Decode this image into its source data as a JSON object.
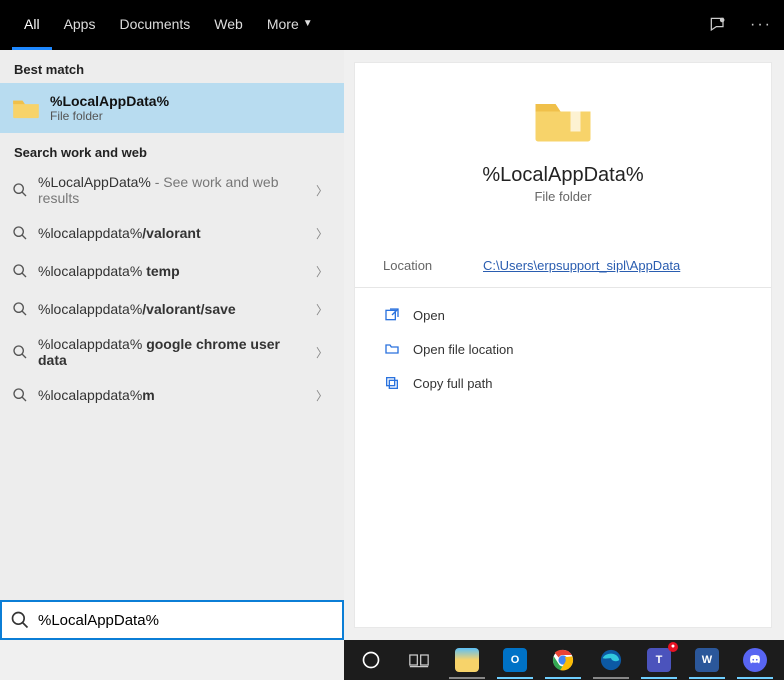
{
  "tabs": {
    "all": "All",
    "apps": "Apps",
    "documents": "Documents",
    "web": "Web",
    "more": "More"
  },
  "sections": {
    "best_match": "Best match",
    "search_web": "Search work and web"
  },
  "best": {
    "title": "%LocalAppData%",
    "sub": "File folder"
  },
  "webresults": [
    {
      "prefix": "%LocalAppData%",
      "suffix": "",
      "extra": " - See work and web results"
    },
    {
      "prefix": "%localappdata%",
      "suffix": "/valorant",
      "extra": ""
    },
    {
      "prefix": "%localappdata% ",
      "suffix": "temp",
      "extra": ""
    },
    {
      "prefix": "%localappdata%",
      "suffix": "/valorant/save",
      "extra": ""
    },
    {
      "prefix": "%localappdata% ",
      "suffix": "google chrome user data",
      "extra": ""
    },
    {
      "prefix": "%localappdata%",
      "suffix": "m",
      "extra": ""
    }
  ],
  "preview": {
    "title": "%LocalAppData%",
    "sub": "File folder",
    "location_label": "Location",
    "location_value": "C:\\Users\\erpsupport_sipl\\AppData"
  },
  "actions": {
    "open": "Open",
    "open_location": "Open file location",
    "copy_path": "Copy full path"
  },
  "search": {
    "value": "%LocalAppData%"
  }
}
